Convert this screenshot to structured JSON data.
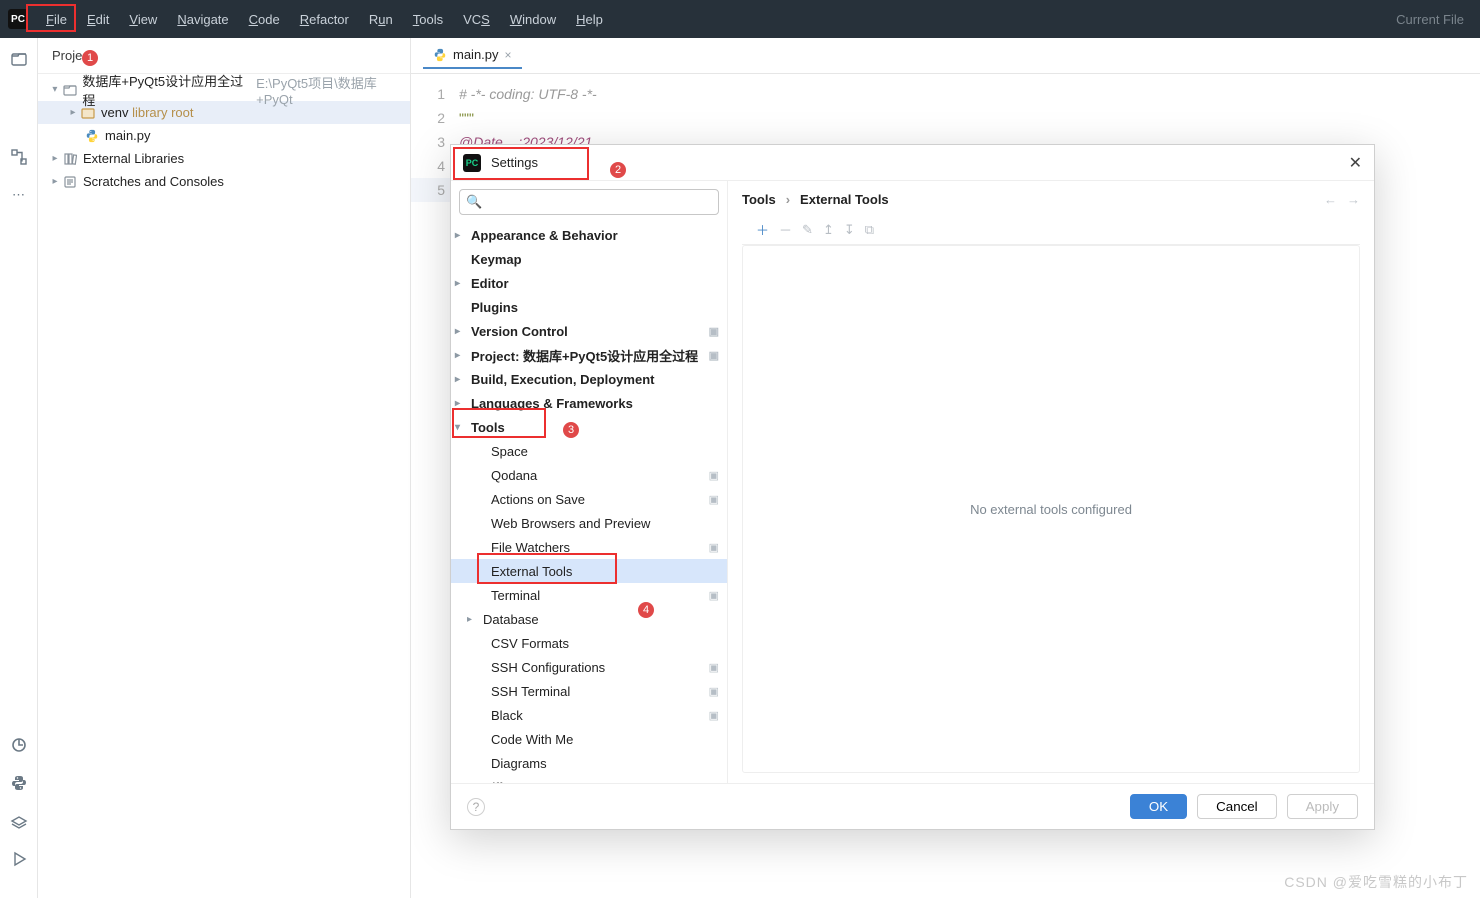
{
  "menubar": {
    "items": [
      "File",
      "Edit",
      "View",
      "Navigate",
      "Code",
      "Refactor",
      "Run",
      "Tools",
      "VCS",
      "Window",
      "Help"
    ],
    "rightStatus": "Current File"
  },
  "projectPanel": {
    "title": "Proje",
    "root": {
      "name": "数据库+PyQt5设计应用全过程",
      "path": "E:\\PyQt5项目\\数据库+PyQt"
    },
    "venv": {
      "name": "venv",
      "tag": "library root"
    },
    "file": "main.py",
    "extLib": "External Libraries",
    "scratches": "Scratches and Consoles"
  },
  "editor": {
    "activeTab": "main.py",
    "lines": {
      "l1": "# -*- coding: UTF-8 -*-",
      "l2": "\"\"\"",
      "l3_partial": "@Date    :2023/12/21",
      "l5": ""
    }
  },
  "settings": {
    "title": "Settings",
    "crumb1": "Tools",
    "crumb2": "External Tools",
    "msg": "No external tools configured",
    "search_placeholder": "",
    "nav": {
      "ab": "Appearance & Behavior",
      "km": "Keymap",
      "ed": "Editor",
      "pl": "Plugins",
      "vc": "Version Control",
      "pr": "Project: 数据库+PyQt5设计应用全过程",
      "be": "Build, Execution, Deployment",
      "lf": "Languages & Frameworks",
      "tl": "Tools",
      "sp": "Space",
      "qd": "Qodana",
      "aos": "Actions on Save",
      "wb": "Web Browsers and Preview",
      "fw": "File Watchers",
      "et": "External Tools",
      "tm": "Terminal",
      "db": "Database",
      "csv": "CSV Formats",
      "ssh": "SSH Configurations",
      "ssht": "SSH Terminal",
      "bk": "Black",
      "cwm": "Code With Me",
      "dg": "Diagrams",
      "dm": "Diff & Merge"
    },
    "buttons": {
      "ok": "OK",
      "cancel": "Cancel",
      "apply": "Apply"
    }
  },
  "annotations": {
    "b1": "1",
    "b2": "2",
    "b3": "3",
    "b4": "4"
  },
  "watermark": "CSDN @爱吃雪糕的小布丁"
}
